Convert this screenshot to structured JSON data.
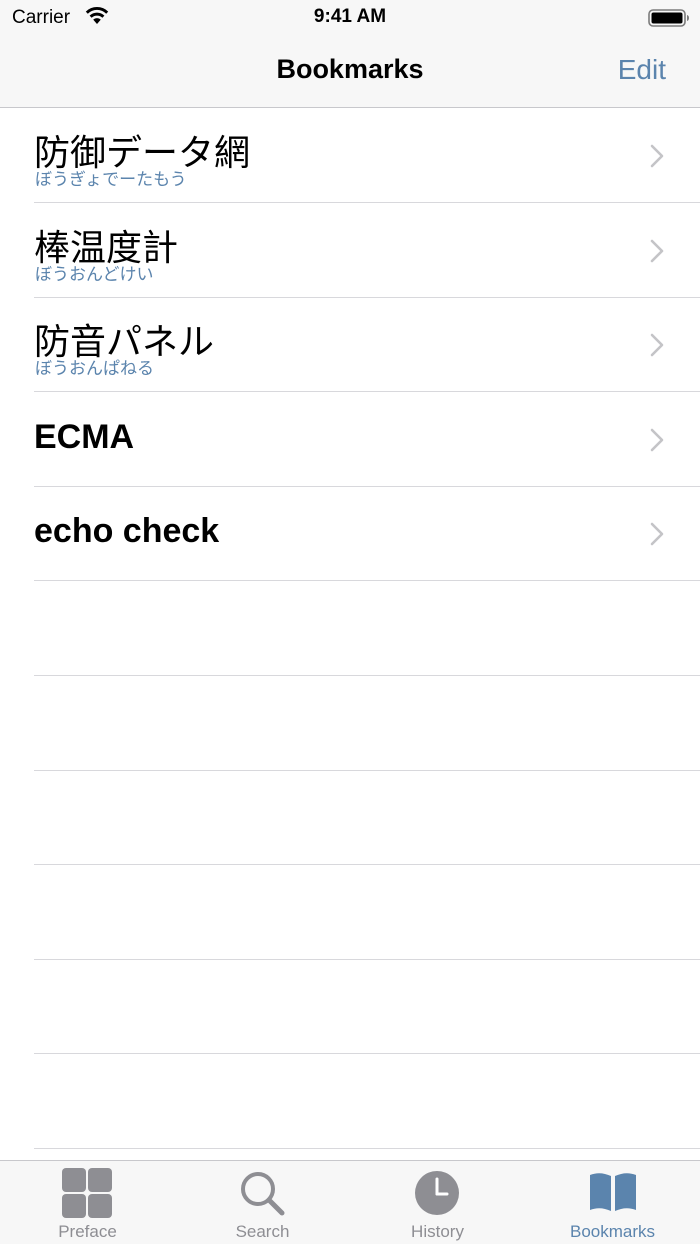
{
  "status": {
    "carrier": "Carrier",
    "time": "9:41 AM"
  },
  "nav": {
    "title": "Bookmarks",
    "edit_label": "Edit"
  },
  "bookmarks": [
    {
      "title": "防御データ網",
      "reading": "ぼうぎょでーたもう"
    },
    {
      "title": "棒温度計",
      "reading": "ぼうおんどけい"
    },
    {
      "title": "防音パネル",
      "reading": "ぼうおんぱねる"
    },
    {
      "title": "ECMA"
    },
    {
      "title": "echo check"
    }
  ],
  "tabs": [
    {
      "label": "Preface",
      "icon": "grid-icon"
    },
    {
      "label": "Search",
      "icon": "search-icon"
    },
    {
      "label": "History",
      "icon": "clock-icon"
    },
    {
      "label": "Bookmarks",
      "icon": "book-icon",
      "active": true
    }
  ],
  "colors": {
    "accent": "#5b84ad",
    "inactive": "#8e8e93",
    "bar_bg": "#f7f7f7"
  }
}
